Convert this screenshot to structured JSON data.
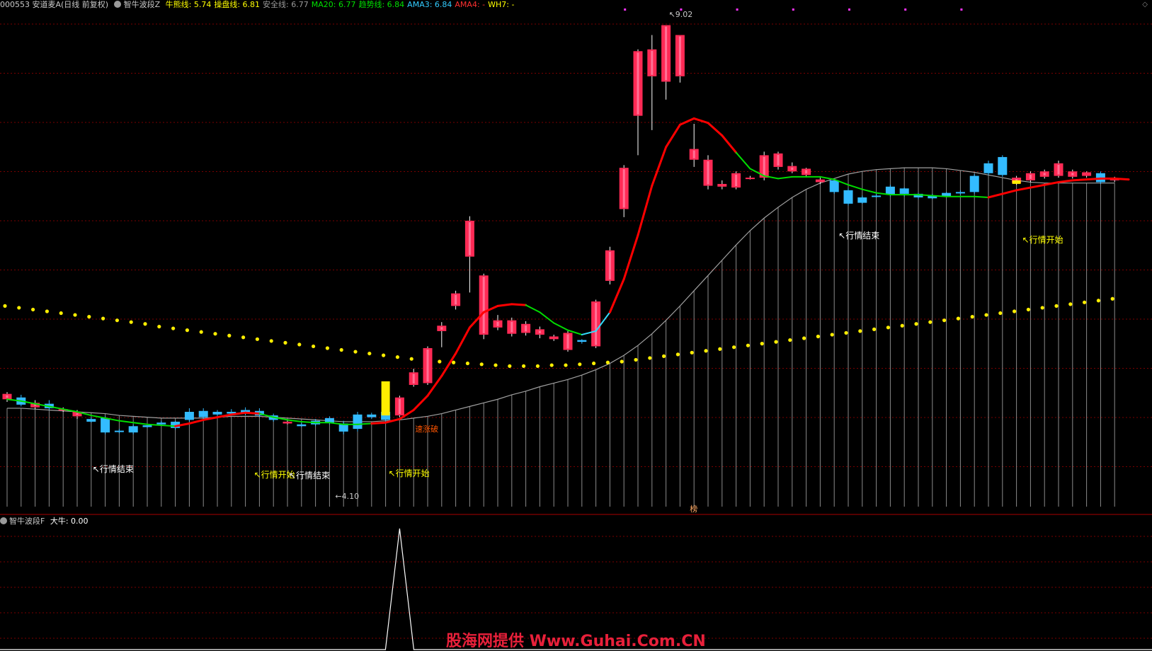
{
  "header": {
    "symbol": "000553 安道麦A(日线 前复权)",
    "indicator": "智牛波段Z",
    "items": [
      {
        "label": "牛熊线:",
        "value": "5.74",
        "color": "#ffff00"
      },
      {
        "label": "操盘线:",
        "value": "6.81",
        "color": "#ffff00"
      },
      {
        "label": "安全线:",
        "value": "6.77",
        "color": "#9a9a9a"
      },
      {
        "label": "MA20:",
        "value": "6.77",
        "color": "#00e000"
      },
      {
        "label": "趋势线:",
        "value": "6.84",
        "color": "#00e000"
      },
      {
        "label": "AMA3:",
        "value": "6.84",
        "color": "#33ccff"
      },
      {
        "label": "AMA4:",
        "value": "-",
        "color": "#ff3030"
      },
      {
        "label": "WH7:",
        "value": "-",
        "color": "#ffff00"
      }
    ]
  },
  "subpanel": {
    "indicator": "智牛波段F",
    "label": "大牛:",
    "value": "0.00"
  },
  "annotations": {
    "high_price": "9.02",
    "low_price": "4.10",
    "end_label": "行情结束",
    "start_label": "行情开始",
    "break_label": "速涨破",
    "bottom_tag": "榜"
  },
  "watermark": "股海网提供 Www.Guhai.Com.CN",
  "colors": {
    "up": "#ff2a55",
    "down": "#33bbff",
    "trend_up": "#ff0000",
    "trend_down": "#00dd00",
    "safe_line": "#a0a0a0",
    "dots": "#ffee00",
    "grid": "#7a0000"
  },
  "chart_data": {
    "type": "candlestick",
    "price_range": [
      3.7,
      9.3
    ],
    "candles": [
      {
        "o": 4.96,
        "c": 5.02,
        "h": 5.04,
        "l": 4.93,
        "up": true
      },
      {
        "o": 4.98,
        "c": 4.9,
        "h": 5.01,
        "l": 4.88,
        "up": false
      },
      {
        "o": 4.92,
        "c": 4.87,
        "h": 4.95,
        "l": 4.85,
        "up": true
      },
      {
        "o": 4.91,
        "c": 4.86,
        "h": 4.95,
        "l": 4.84,
        "up": false
      },
      {
        "o": 4.85,
        "c": 4.84,
        "h": 4.87,
        "l": 4.82,
        "up": true
      },
      {
        "o": 4.82,
        "c": 4.77,
        "h": 4.84,
        "l": 4.74,
        "up": true
      },
      {
        "o": 4.74,
        "c": 4.71,
        "h": 4.76,
        "l": 4.7,
        "up": false
      },
      {
        "o": 4.75,
        "c": 4.59,
        "h": 4.77,
        "l": 4.57,
        "up": false
      },
      {
        "o": 4.61,
        "c": 4.6,
        "h": 4.63,
        "l": 4.58,
        "up": false
      },
      {
        "o": 4.66,
        "c": 4.59,
        "h": 4.68,
        "l": 4.57,
        "up": false
      },
      {
        "o": 4.67,
        "c": 4.65,
        "h": 4.69,
        "l": 4.64,
        "up": false
      },
      {
        "o": 4.7,
        "c": 4.68,
        "h": 4.72,
        "l": 4.67,
        "up": false
      },
      {
        "o": 4.71,
        "c": 4.64,
        "h": 4.72,
        "l": 4.62,
        "up": false
      },
      {
        "o": 4.82,
        "c": 4.73,
        "h": 4.86,
        "l": 4.71,
        "up": false
      },
      {
        "o": 4.83,
        "c": 4.76,
        "h": 4.86,
        "l": 4.74,
        "up": false
      },
      {
        "o": 4.82,
        "c": 4.79,
        "h": 4.84,
        "l": 4.77,
        "up": false
      },
      {
        "o": 4.82,
        "c": 4.8,
        "h": 4.85,
        "l": 4.79,
        "up": false
      },
      {
        "o": 4.84,
        "c": 4.8,
        "h": 4.87,
        "l": 4.78,
        "up": false
      },
      {
        "o": 4.83,
        "c": 4.78,
        "h": 4.86,
        "l": 4.76,
        "up": false
      },
      {
        "o": 4.78,
        "c": 4.73,
        "h": 4.8,
        "l": 4.71,
        "up": false
      },
      {
        "o": 4.71,
        "c": 4.69,
        "h": 4.73,
        "l": 4.68,
        "up": true
      },
      {
        "o": 4.68,
        "c": 4.66,
        "h": 4.7,
        "l": 4.65,
        "up": false
      },
      {
        "o": 4.72,
        "c": 4.68,
        "h": 4.74,
        "l": 4.66,
        "up": false
      },
      {
        "o": 4.75,
        "c": 4.7,
        "h": 4.77,
        "l": 4.68,
        "up": false
      },
      {
        "o": 4.69,
        "c": 4.6,
        "h": 4.72,
        "l": 4.57,
        "up": false
      },
      {
        "o": 4.79,
        "c": 4.63,
        "h": 4.82,
        "l": 4.6,
        "up": false
      },
      {
        "o": 4.79,
        "c": 4.76,
        "h": 4.81,
        "l": 4.74,
        "up": false
      },
      {
        "o": 4.82,
        "c": 4.73,
        "h": 4.84,
        "l": 4.71,
        "up": false
      },
      {
        "o": 4.78,
        "c": 4.98,
        "h": 5.0,
        "l": 4.76,
        "up": true
      },
      {
        "o": 5.12,
        "c": 5.26,
        "h": 5.3,
        "l": 5.1,
        "up": true
      },
      {
        "o": 5.14,
        "c": 5.53,
        "h": 5.55,
        "l": 5.12,
        "up": true
      },
      {
        "o": 5.72,
        "c": 5.78,
        "h": 5.82,
        "l": 5.54,
        "up": true
      },
      {
        "o": 6.0,
        "c": 6.14,
        "h": 6.17,
        "l": 5.96,
        "up": true
      },
      {
        "o": 6.55,
        "c": 6.95,
        "h": 7.0,
        "l": 6.15,
        "up": true
      },
      {
        "o": 5.68,
        "c": 6.34,
        "h": 6.36,
        "l": 5.63,
        "up": true
      },
      {
        "o": 5.76,
        "c": 5.84,
        "h": 5.9,
        "l": 5.73,
        "up": true
      },
      {
        "o": 5.69,
        "c": 5.84,
        "h": 5.87,
        "l": 5.66,
        "up": true
      },
      {
        "o": 5.7,
        "c": 5.8,
        "h": 5.83,
        "l": 5.67,
        "up": true
      },
      {
        "o": 5.68,
        "c": 5.74,
        "h": 5.77,
        "l": 5.64,
        "up": true
      },
      {
        "o": 5.63,
        "c": 5.66,
        "h": 5.68,
        "l": 5.61,
        "up": true
      },
      {
        "o": 5.51,
        "c": 5.7,
        "h": 5.72,
        "l": 5.49,
        "up": true
      },
      {
        "o": 5.6,
        "c": 5.62,
        "h": 5.63,
        "l": 5.58,
        "up": false
      },
      {
        "o": 5.55,
        "c": 6.05,
        "h": 6.07,
        "l": 5.53,
        "up": true
      },
      {
        "o": 6.28,
        "c": 6.62,
        "h": 6.66,
        "l": 6.24,
        "up": true
      },
      {
        "o": 7.08,
        "c": 7.54,
        "h": 7.57,
        "l": 6.99,
        "up": true
      },
      {
        "o": 8.12,
        "c": 8.84,
        "h": 8.86,
        "l": 7.68,
        "up": true
      },
      {
        "o": 8.56,
        "c": 8.86,
        "h": 9.02,
        "l": 7.96,
        "up": true
      },
      {
        "o": 8.5,
        "c": 9.13,
        "h": 9.02,
        "l": 8.3,
        "up": true
      },
      {
        "o": 8.56,
        "c": 9.02,
        "h": 9.02,
        "l": 8.49,
        "up": true
      },
      {
        "o": 7.63,
        "c": 7.75,
        "h": 8.03,
        "l": 7.55,
        "up": true
      },
      {
        "o": 7.34,
        "c": 7.63,
        "h": 7.68,
        "l": 7.3,
        "up": true
      },
      {
        "o": 7.33,
        "c": 7.36,
        "h": 7.4,
        "l": 7.3,
        "up": true
      },
      {
        "o": 7.32,
        "c": 7.48,
        "h": 7.5,
        "l": 7.3,
        "up": true
      },
      {
        "o": 7.43,
        "c": 7.43,
        "h": 7.45,
        "l": 7.41,
        "up": true
      },
      {
        "o": 7.43,
        "c": 7.68,
        "h": 7.72,
        "l": 7.4,
        "up": true
      },
      {
        "o": 7.55,
        "c": 7.7,
        "h": 7.72,
        "l": 7.52,
        "up": true
      },
      {
        "o": 7.5,
        "c": 7.56,
        "h": 7.6,
        "l": 7.48,
        "up": true
      },
      {
        "o": 7.46,
        "c": 7.53,
        "h": 7.54,
        "l": 7.44,
        "up": true
      },
      {
        "o": 7.38,
        "c": 7.41,
        "h": 7.43,
        "l": 7.36,
        "up": true
      },
      {
        "o": 7.27,
        "c": 7.4,
        "h": 7.42,
        "l": 7.25,
        "up": false
      },
      {
        "o": 7.14,
        "c": 7.29,
        "h": 7.31,
        "l": 7.12,
        "up": false
      },
      {
        "o": 7.15,
        "c": 7.21,
        "h": 7.23,
        "l": 7.14,
        "up": false
      },
      {
        "o": 7.23,
        "c": 7.23,
        "h": 7.25,
        "l": 7.21,
        "up": false
      },
      {
        "o": 7.24,
        "c": 7.33,
        "h": 7.35,
        "l": 7.22,
        "up": false
      },
      {
        "o": 7.25,
        "c": 7.31,
        "h": 7.32,
        "l": 7.22,
        "up": false
      },
      {
        "o": 7.21,
        "c": 7.25,
        "h": 7.26,
        "l": 7.19,
        "up": false
      },
      {
        "o": 7.2,
        "c": 7.23,
        "h": 7.25,
        "l": 7.19,
        "up": false
      },
      {
        "o": 7.22,
        "c": 7.26,
        "h": 7.27,
        "l": 7.21,
        "up": false
      },
      {
        "o": 7.26,
        "c": 7.27,
        "h": 7.29,
        "l": 7.24,
        "up": false
      },
      {
        "o": 7.27,
        "c": 7.45,
        "h": 7.47,
        "l": 7.25,
        "up": false
      },
      {
        "o": 7.48,
        "c": 7.59,
        "h": 7.62,
        "l": 7.46,
        "up": false
      },
      {
        "o": 7.46,
        "c": 7.66,
        "h": 7.68,
        "l": 7.44,
        "up": false
      },
      {
        "o": 7.37,
        "c": 7.43,
        "h": 7.45,
        "l": 7.35,
        "up": true
      },
      {
        "o": 7.4,
        "c": 7.48,
        "h": 7.5,
        "l": 7.38,
        "up": true
      },
      {
        "o": 7.44,
        "c": 7.5,
        "h": 7.52,
        "l": 7.42,
        "up": true
      },
      {
        "o": 7.45,
        "c": 7.59,
        "h": 7.62,
        "l": 7.43,
        "up": true
      },
      {
        "o": 7.44,
        "c": 7.5,
        "h": 7.52,
        "l": 7.42,
        "up": true
      },
      {
        "o": 7.45,
        "c": 7.49,
        "h": 7.5,
        "l": 7.43,
        "up": true
      },
      {
        "o": 7.38,
        "c": 7.48,
        "h": 7.5,
        "l": 7.36,
        "up": false
      },
      {
        "o": 7.4,
        "c": 7.42,
        "h": 7.44,
        "l": 7.38,
        "up": true
      }
    ],
    "trend_line": [
      {
        "v": 4.96,
        "c": "g"
      },
      {
        "v": 4.94,
        "c": "g"
      },
      {
        "v": 4.91,
        "c": "g"
      },
      {
        "v": 4.88,
        "c": "g"
      },
      {
        "v": 4.85,
        "c": "g"
      },
      {
        "v": 4.82,
        "c": "g"
      },
      {
        "v": 4.78,
        "c": "g"
      },
      {
        "v": 4.75,
        "c": "g"
      },
      {
        "v": 4.72,
        "c": "g"
      },
      {
        "v": 4.7,
        "c": "g"
      },
      {
        "v": 4.68,
        "c": "g"
      },
      {
        "v": 4.67,
        "c": "g"
      },
      {
        "v": 4.66,
        "c": "g"
      },
      {
        "v": 4.69,
        "c": "r"
      },
      {
        "v": 4.73,
        "c": "r"
      },
      {
        "v": 4.76,
        "c": "r"
      },
      {
        "v": 4.79,
        "c": "r"
      },
      {
        "v": 4.81,
        "c": "r"
      },
      {
        "v": 4.8,
        "c": "r"
      },
      {
        "v": 4.76,
        "c": "g"
      },
      {
        "v": 4.73,
        "c": "g"
      },
      {
        "v": 4.71,
        "c": "g"
      },
      {
        "v": 4.7,
        "c": "g"
      },
      {
        "v": 4.7,
        "c": "g"
      },
      {
        "v": 4.68,
        "c": "g"
      },
      {
        "v": 4.68,
        "c": "g"
      },
      {
        "v": 4.69,
        "c": "g"
      },
      {
        "v": 4.7,
        "c": "r"
      },
      {
        "v": 4.74,
        "c": "r"
      },
      {
        "v": 4.84,
        "c": "r"
      },
      {
        "v": 5.0,
        "c": "r"
      },
      {
        "v": 5.22,
        "c": "r"
      },
      {
        "v": 5.47,
        "c": "r"
      },
      {
        "v": 5.76,
        "c": "r"
      },
      {
        "v": 5.93,
        "c": "r"
      },
      {
        "v": 6.0,
        "c": "r"
      },
      {
        "v": 6.02,
        "c": "r"
      },
      {
        "v": 6.01,
        "c": "r"
      },
      {
        "v": 5.93,
        "c": "g"
      },
      {
        "v": 5.81,
        "c": "g"
      },
      {
        "v": 5.73,
        "c": "g"
      },
      {
        "v": 5.68,
        "c": "g"
      },
      {
        "v": 5.72,
        "c": "c"
      },
      {
        "v": 5.93,
        "c": "c"
      },
      {
        "v": 6.3,
        "c": "r"
      },
      {
        "v": 6.79,
        "c": "r"
      },
      {
        "v": 7.34,
        "c": "r"
      },
      {
        "v": 7.77,
        "c": "r"
      },
      {
        "v": 8.02,
        "c": "r"
      },
      {
        "v": 8.09,
        "c": "r"
      },
      {
        "v": 8.04,
        "c": "r"
      },
      {
        "v": 7.9,
        "c": "r"
      },
      {
        "v": 7.71,
        "c": "r"
      },
      {
        "v": 7.53,
        "c": "g"
      },
      {
        "v": 7.45,
        "c": "g"
      },
      {
        "v": 7.42,
        "c": "g"
      },
      {
        "v": 7.44,
        "c": "g"
      },
      {
        "v": 7.44,
        "c": "g"
      },
      {
        "v": 7.44,
        "c": "g"
      },
      {
        "v": 7.41,
        "c": "g"
      },
      {
        "v": 7.35,
        "c": "g"
      },
      {
        "v": 7.3,
        "c": "g"
      },
      {
        "v": 7.26,
        "c": "g"
      },
      {
        "v": 7.24,
        "c": "g"
      },
      {
        "v": 7.24,
        "c": "g"
      },
      {
        "v": 7.24,
        "c": "g"
      },
      {
        "v": 7.23,
        "c": "g"
      },
      {
        "v": 7.22,
        "c": "g"
      },
      {
        "v": 7.22,
        "c": "g"
      },
      {
        "v": 7.22,
        "c": "g"
      },
      {
        "v": 7.21,
        "c": "g"
      },
      {
        "v": 7.25,
        "c": "r"
      },
      {
        "v": 7.29,
        "c": "r"
      },
      {
        "v": 7.32,
        "c": "r"
      },
      {
        "v": 7.35,
        "c": "r"
      },
      {
        "v": 7.38,
        "c": "r"
      },
      {
        "v": 7.4,
        "c": "r"
      },
      {
        "v": 7.41,
        "c": "r"
      },
      {
        "v": 7.42,
        "c": "r"
      },
      {
        "v": 7.42,
        "c": "r"
      },
      {
        "v": 7.41,
        "c": "r"
      }
    ],
    "safe_line": [
      4.86,
      4.86,
      4.85,
      4.84,
      4.83,
      4.82,
      4.81,
      4.8,
      4.78,
      4.77,
      4.76,
      4.75,
      4.75,
      4.75,
      4.75,
      4.76,
      4.77,
      4.77,
      4.77,
      4.76,
      4.75,
      4.74,
      4.73,
      4.72,
      4.71,
      4.71,
      4.71,
      4.72,
      4.73,
      4.75,
      4.77,
      4.8,
      4.84,
      4.88,
      4.92,
      4.96,
      5.01,
      5.05,
      5.1,
      5.14,
      5.18,
      5.23,
      5.29,
      5.36,
      5.45,
      5.56,
      5.69,
      5.84,
      6.0,
      6.17,
      6.34,
      6.51,
      6.68,
      6.84,
      6.98,
      7.1,
      7.21,
      7.3,
      7.37,
      7.42,
      7.47,
      7.5,
      7.52,
      7.53,
      7.54,
      7.54,
      7.54,
      7.53,
      7.51,
      7.49,
      7.46,
      7.43,
      7.4,
      7.38,
      7.37,
      7.37,
      7.37,
      7.37,
      7.37,
      7.37
    ],
    "bull_bear_dots": [
      6.0,
      5.98,
      5.96,
      5.94,
      5.92,
      5.9,
      5.88,
      5.86,
      5.84,
      5.82,
      5.8,
      5.77,
      5.75,
      5.73,
      5.71,
      5.69,
      5.67,
      5.65,
      5.63,
      5.61,
      5.59,
      5.57,
      5.55,
      5.53,
      5.51,
      5.49,
      5.47,
      5.45,
      5.43,
      5.41,
      5.39,
      5.38,
      5.37,
      5.36,
      5.35,
      5.34,
      5.33,
      5.33,
      5.33,
      5.34,
      5.34,
      5.35,
      5.36,
      5.37,
      5.38,
      5.4,
      5.42,
      5.44,
      5.46,
      5.48,
      5.5,
      5.52,
      5.54,
      5.56,
      5.58,
      5.6,
      5.62,
      5.64,
      5.66,
      5.68,
      5.7,
      5.72,
      5.74,
      5.76,
      5.78,
      5.8,
      5.82,
      5.84,
      5.86,
      5.88,
      5.9,
      5.92,
      5.94,
      5.96,
      5.98,
      6.0,
      6.02,
      6.04,
      6.06,
      6.08
    ],
    "signal_line": {
      "x_index": 28,
      "peak": 1,
      "range": [
        0,
        1
      ]
    }
  }
}
